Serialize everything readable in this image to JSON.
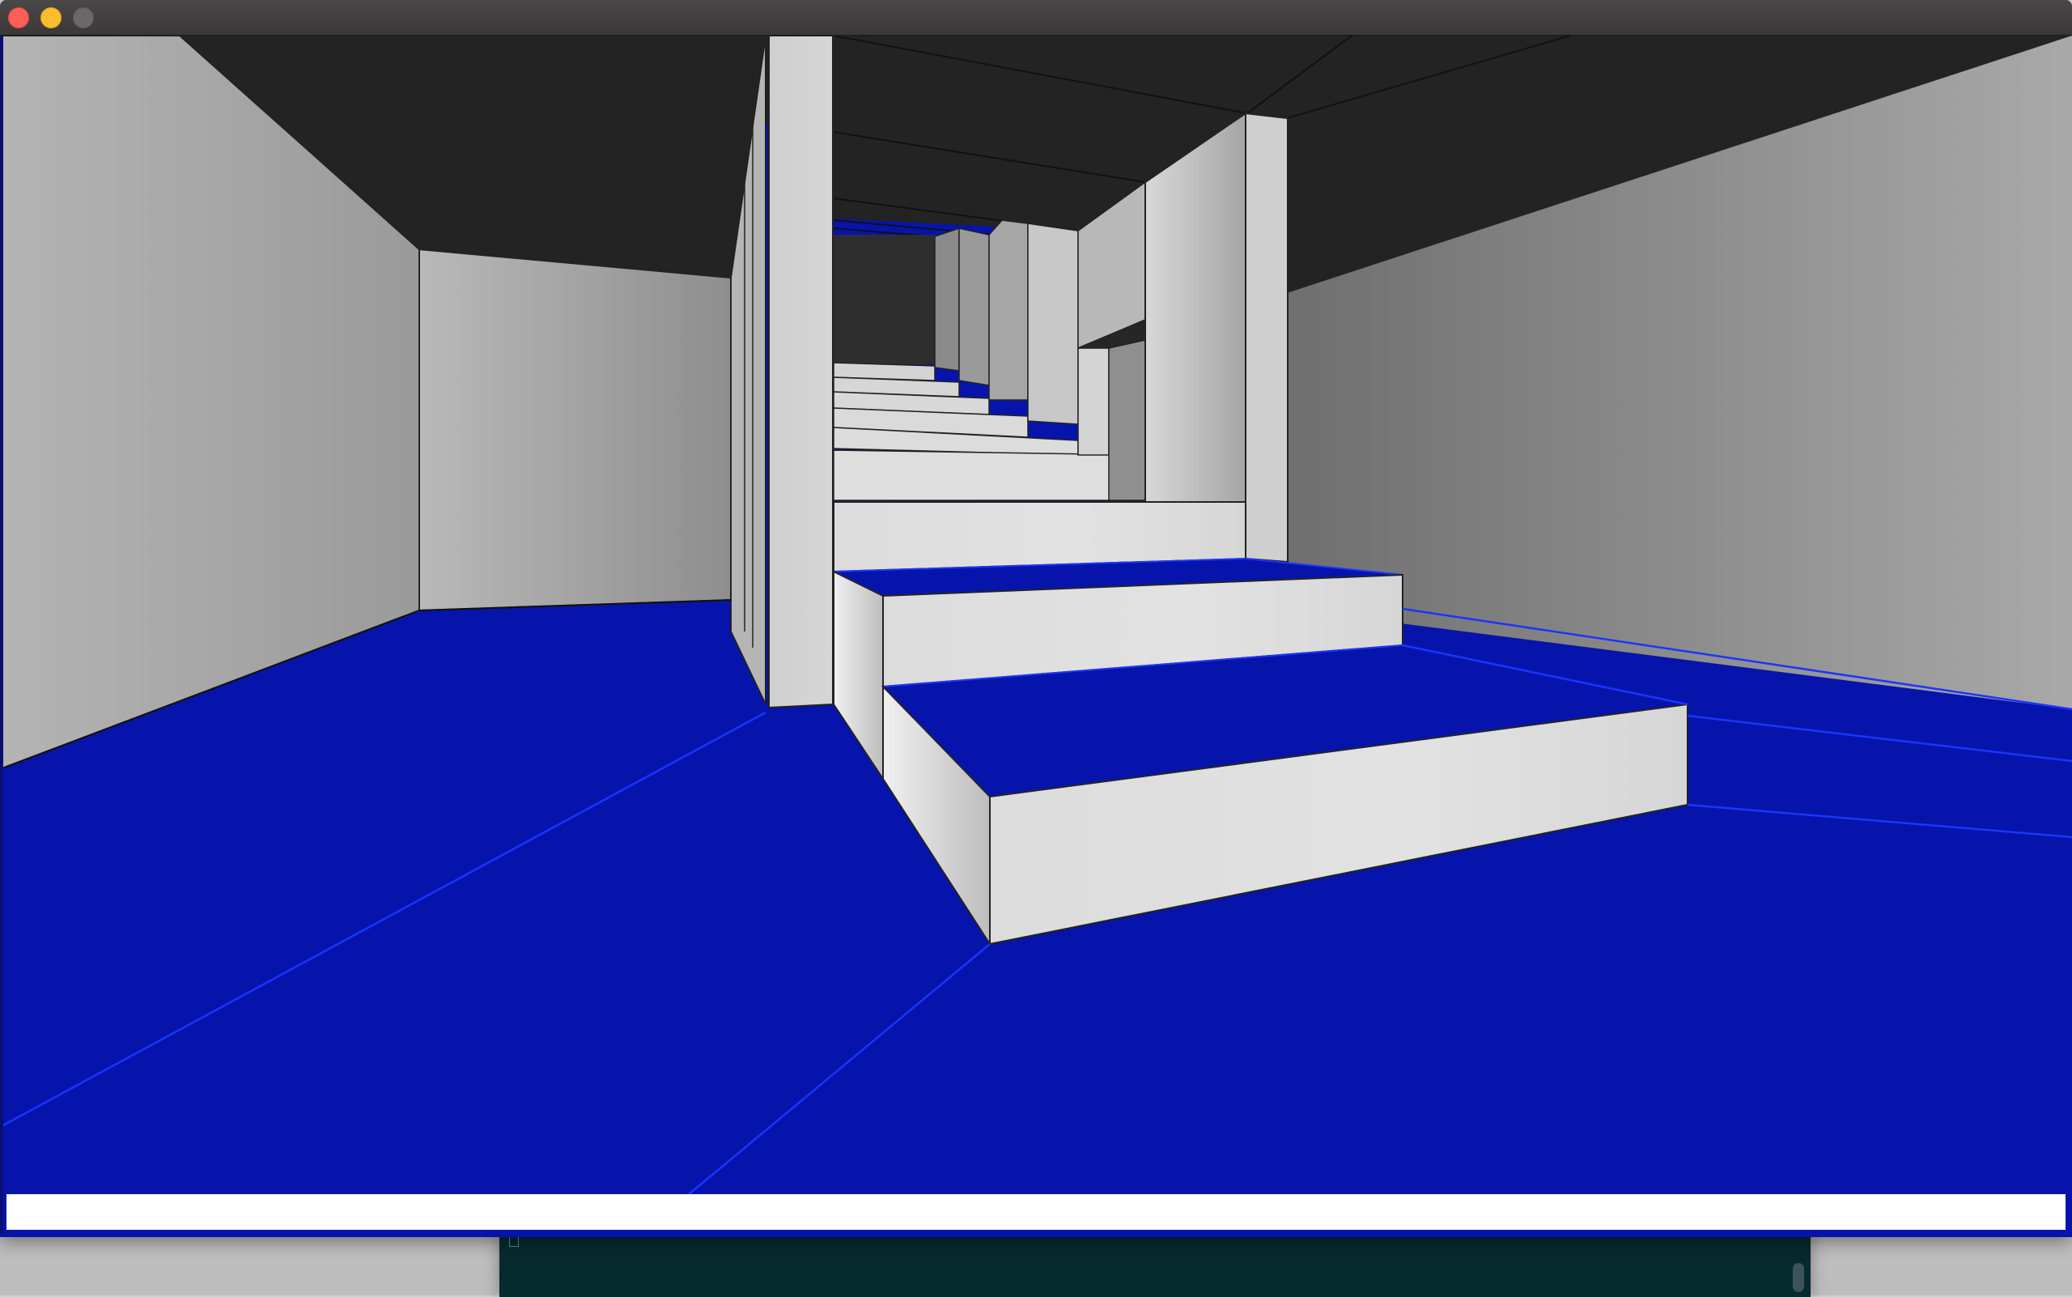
{
  "desktop": {
    "terminal": {
      "cursor_icon": "block-cursor-icon"
    }
  },
  "window": {
    "title": "",
    "buttons": {
      "close": "close",
      "minimize": "minimize",
      "zoom": "zoom"
    }
  },
  "scene": {
    "description_icons": [
      "wall",
      "ceiling",
      "floor",
      "stairs",
      "pillar"
    ],
    "colors": {
      "floor": "#0614ac",
      "floor_lines": "#1b34ff",
      "ceiling": "#232323",
      "wall_light": "#dedede",
      "wall_mid": "#a8a8a8",
      "wall_dark": "#7a7a7a"
    }
  },
  "status_bar": {
    "text": ""
  }
}
